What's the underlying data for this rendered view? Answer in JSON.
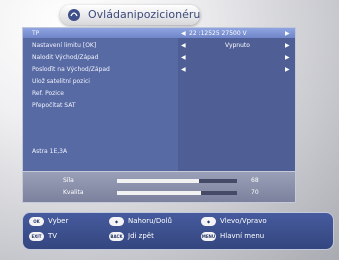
{
  "header": {
    "title": "Ovládanipozicionéru"
  },
  "menu": {
    "items": [
      "TP",
      "Nastavení limitu [OK]",
      "Nalodit Východ/Západ",
      "Posloďit na Východ/Západ",
      "Ulož satelitní pozici",
      "Ref. Pozice",
      "Přepočítat SAT"
    ],
    "values": [
      "22 :12525 27500 V",
      "Vypnuto"
    ],
    "satellite": "Astra 1E,3A"
  },
  "signal": {
    "strength_label": "Síla",
    "strength_value": "68",
    "quality_label": "Kvalita",
    "quality_value": "70",
    "strength_fraction": 0.68,
    "quality_fraction": 0.7
  },
  "footer": {
    "items": [
      {
        "button": "OK",
        "label": "Vyber"
      },
      {
        "button": "◆",
        "label": "Nahoru/Dolů"
      },
      {
        "button": "◆",
        "label": "Vlevo/Vpravo"
      },
      {
        "button": "EXIT",
        "label": "TV"
      },
      {
        "button": "BACK",
        "label": "Jdi zpět"
      },
      {
        "button": "MENU",
        "label": "Hlavní menu"
      }
    ]
  },
  "colors": {
    "panel": "#586aa4",
    "highlight": "#7f95d8",
    "footer": "#3f5391"
  }
}
